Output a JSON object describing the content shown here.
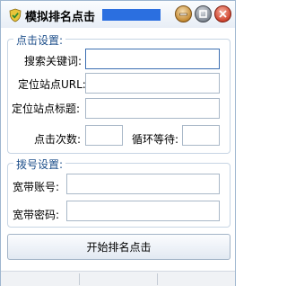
{
  "window": {
    "title": "模拟排名点击",
    "icon": "shield-check-icon",
    "controls": [
      "minimize-icon",
      "maximize-icon",
      "close-icon"
    ]
  },
  "click_settings": {
    "legend": "点击设置:",
    "search_keyword_label": "搜索关键词:",
    "search_keyword_value": "",
    "locate_url_label": "定位站点URL:",
    "locate_url_value": "",
    "locate_title_label": "定位站点标题:",
    "locate_title_value": "",
    "click_count_label": "点击次数:",
    "click_count_value": "",
    "loop_wait_label": "循环等待:",
    "loop_wait_value": ""
  },
  "dial_settings": {
    "legend": "拨号设置:",
    "account_label": "宽带账号:",
    "account_value": "",
    "password_label": "宽带密码:",
    "password_value": ""
  },
  "actions": {
    "start_label": "开始排名点击"
  },
  "colors": {
    "legend_text": "#1c4e8a",
    "title_redaction": "#2b6fe0"
  }
}
